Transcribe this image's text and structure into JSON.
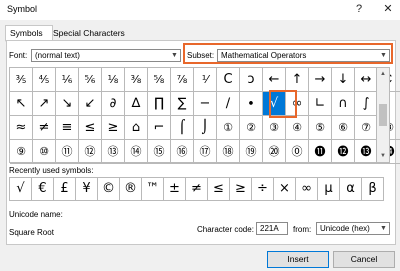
{
  "window": {
    "title": "Symbol",
    "help": "?",
    "close": "✕"
  },
  "tabs": [
    {
      "label": "Symbols",
      "active": true
    },
    {
      "label": "Special Characters",
      "active": false
    }
  ],
  "font": {
    "label": "Font:",
    "value": "(normal text)"
  },
  "subset": {
    "label": "Subset:",
    "value": "Mathematical Operators"
  },
  "symbols": [
    [
      "⅗",
      "⅘",
      "⅙",
      "⅚",
      "⅛",
      "⅜",
      "⅝",
      "⅞",
      "⅟",
      "Ⅽ",
      "ↄ",
      "←",
      "↑",
      "→",
      "↓",
      "↔",
      "↕"
    ],
    [
      "↖",
      "↗",
      "↘",
      "↙",
      "∂",
      "∆",
      "∏",
      "∑",
      "−",
      "∕",
      "∙",
      "√",
      "∞",
      "∟",
      "∩",
      "∫"
    ],
    [
      "≈",
      "≠",
      "≡",
      "≤",
      "≥",
      "⌂",
      "⌐",
      "⌠",
      "⌡",
      "①",
      "②",
      "③",
      "④",
      "⑤",
      "⑥",
      "⑦",
      "⑧"
    ],
    [
      "⑨",
      "⑩",
      "⑪",
      "⑫",
      "⑬",
      "⑭",
      "⑮",
      "⑯",
      "⑰",
      "⑱",
      "⑲",
      "⑳",
      "⓪",
      "⓫",
      "⓬",
      "⓭",
      "⓮"
    ]
  ],
  "selected_symbol": "√",
  "recent": {
    "label": "Recently used symbols:",
    "items": [
      "√",
      "€",
      "£",
      "¥",
      "©",
      "®",
      "™",
      "±",
      "≠",
      "≤",
      "≥",
      "÷",
      "×",
      "∞",
      "µ",
      "α",
      "β"
    ]
  },
  "unicode_name": {
    "label": "Unicode name:",
    "value": "Square Root"
  },
  "character_code": {
    "label": "Character code:",
    "value": "221A"
  },
  "from": {
    "label": "from:",
    "value": "Unicode (hex)"
  },
  "buttons": {
    "insert": "Insert",
    "cancel": "Cancel"
  },
  "colors": {
    "selection": "#0078d7",
    "highlight": "#e8672b"
  }
}
